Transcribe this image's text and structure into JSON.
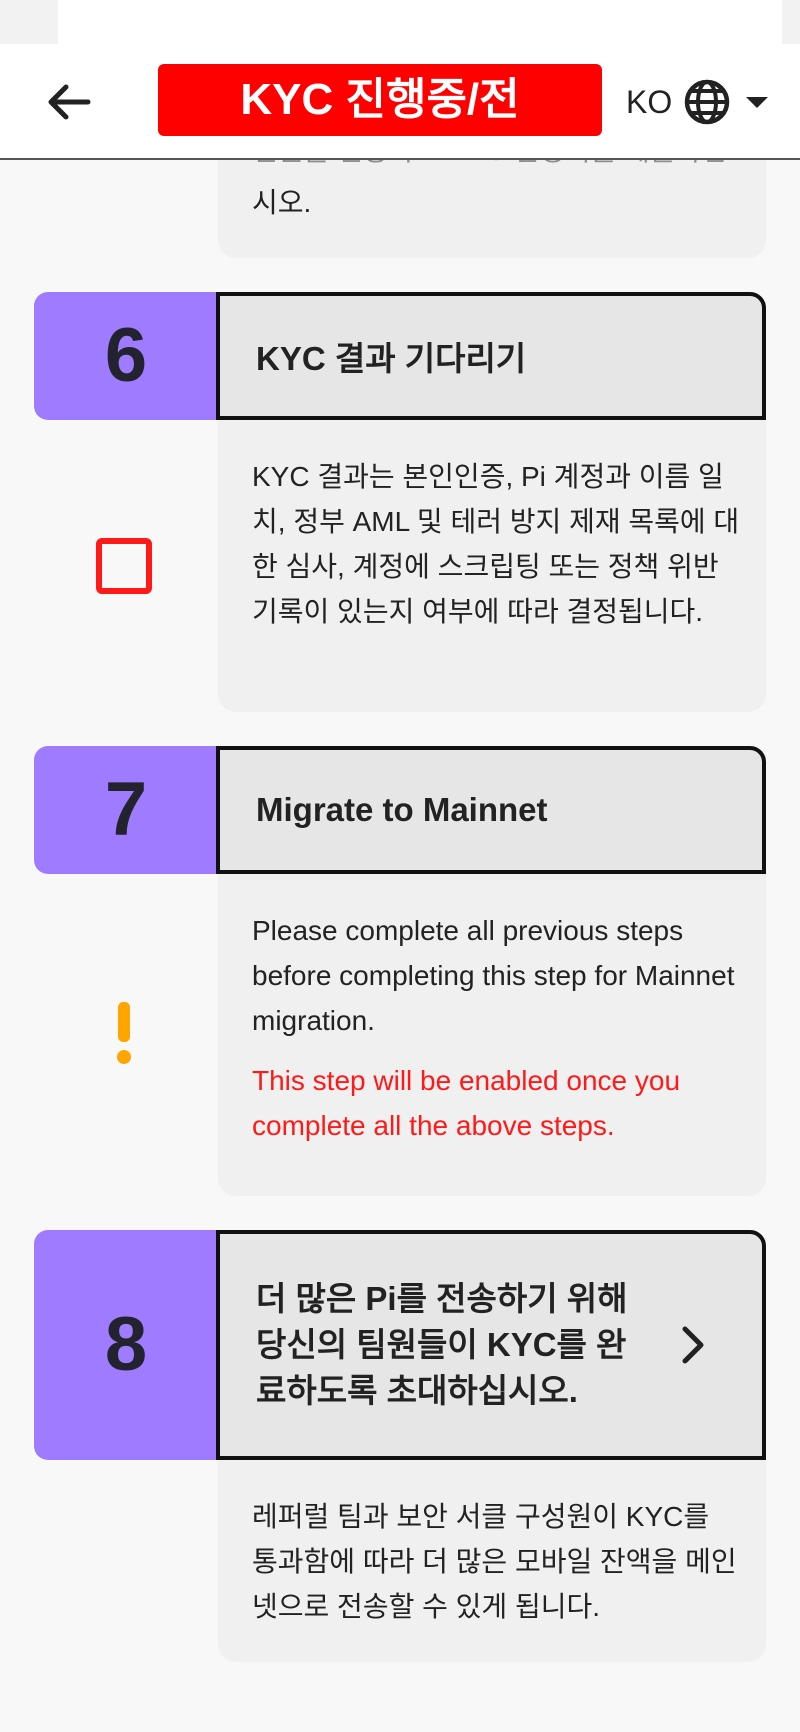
{
  "header": {
    "title": "KYC 진행중/전",
    "lang_code": "KO"
  },
  "prev_step": {
    "desc_faded": "신원을 인증하고 KYC 신청서를 제출하십",
    "desc_tail": "시오."
  },
  "steps": [
    {
      "number": "6",
      "title": "KYC 결과 기다리기",
      "description": "KYC 결과는 본인인증, Pi 계정과 이름 일치, 정부 AML 및 테러 방지 제재 목록에 대한 심사, 계정에 스크립팅 또는 정책 위반 기록이 있는지 여부에 따라 결정됩니다.",
      "status_icon": "empty-checkbox-icon"
    },
    {
      "number": "7",
      "title": "Migrate to Mainnet",
      "description": "Please complete all previous steps before completing this step for Mainnet migration.",
      "notice": "This step will be enabled once you complete all the above steps.",
      "status_icon": "warning-icon"
    },
    {
      "number": "8",
      "title": "더 많은 Pi를 전송하기 위해 당신의 팀원들이 KYC를 완료하도록 초대하십시오.",
      "description": "레퍼럴 팀과 보안 서클 구성원이 KYC를 통과함에 따라 더 많은 모바일 잔액을 메인넷으로 전송할 수 있게 됩니다."
    }
  ],
  "colors": {
    "step_number_bg": "#9e7bff",
    "title_badge_bg": "#ff0000",
    "notice_text": "#ff1a1a",
    "warning": "#ffa500"
  }
}
